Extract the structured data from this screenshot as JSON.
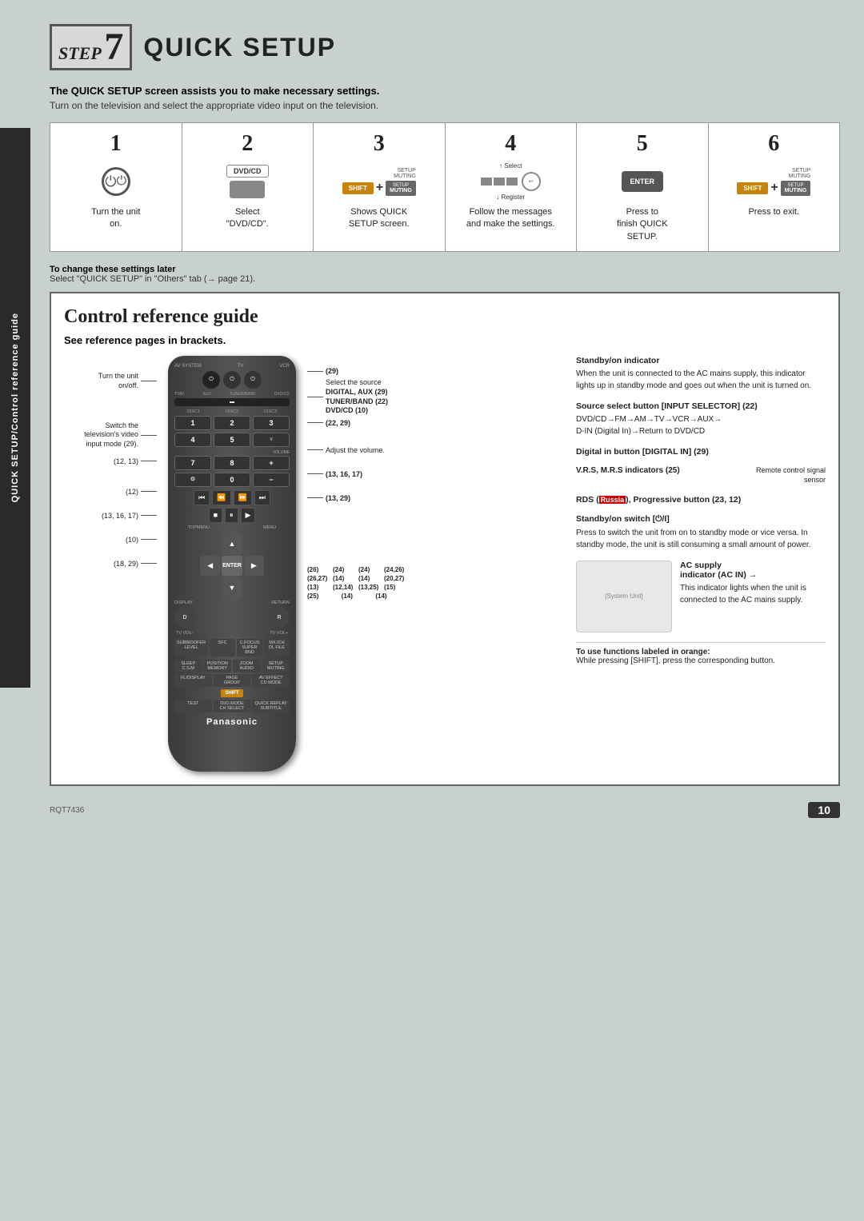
{
  "page": {
    "background_color": "#c0c8c8",
    "footer_code": "RQT7436",
    "page_number": "10"
  },
  "side_label": "QUICK SETUP/Control reference guide",
  "header": {
    "step_word": "STEP",
    "step_number": "7",
    "title": "QUICK SETUP"
  },
  "intro": {
    "bold_text": "The QUICK SETUP screen assists you to make necessary settings.",
    "normal_text": "Turn on the television and select the appropriate video input on the television."
  },
  "steps": [
    {
      "number": "1",
      "icon_type": "power",
      "desc_line1": "Turn the unit",
      "desc_line2": "on."
    },
    {
      "number": "2",
      "icon_type": "dvdcd",
      "btn_label": "DVD/CD",
      "desc_line1": "Select",
      "desc_line2": "\"DVD/CD\"."
    },
    {
      "number": "3",
      "icon_type": "shift_muting",
      "shift_label": "SHIFT",
      "setup_label": "SETUP",
      "muting_label": "MUTING",
      "desc_line1": "Shows QUICK",
      "desc_line2": "SETUP screen."
    },
    {
      "number": "4",
      "icon_type": "arrows_return",
      "select_label": "Select",
      "register_label": "Register",
      "return_label": "RETURN",
      "desc_line1": "Follow the messages",
      "desc_line2": "and make the settings."
    },
    {
      "number": "5",
      "icon_type": "enter",
      "enter_label": "ENTER",
      "desc_line1": "Press to",
      "desc_line2": "finish QUICK",
      "desc_line3": "SETUP."
    },
    {
      "number": "6",
      "icon_type": "shift_muting2",
      "shift_label": "SHIFT",
      "setup_label": "SETUP",
      "muting_label": "MUTING",
      "desc_line1": "Press to exit."
    }
  ],
  "change_note": {
    "bold": "To change these settings later",
    "text": "Select \"QUICK SETUP\" in \"Others\" tab (→ page 21)."
  },
  "control_ref": {
    "title": "Control reference guide",
    "subtitle": "See reference pages in brackets.",
    "annotations_left": [
      {
        "text": "Turn the unit\non/off.",
        "number": ""
      },
      {
        "text": "Switch the\ntelevision's video\ninput mode (29).",
        "number": "(29)"
      },
      {
        "text": "12, 13",
        "number": "(12, 13)"
      },
      {
        "text": "12",
        "number": "(12)"
      },
      {
        "text": "13, 16, 17",
        "number": "(13, 16, 17)"
      },
      {
        "text": "10",
        "number": "(10)"
      },
      {
        "text": "18, 29",
        "number": "(18, 29)"
      }
    ],
    "annotations_right": [
      {
        "text": "(29)",
        "desc": ""
      },
      {
        "text": "Select the source\nDIGITAL, AUX (29)\nTUNER/BAND (22)\nDVD/CD (10)"
      },
      {
        "text": "(22, 29)"
      },
      {
        "text": "Adjust the volume."
      },
      {
        "text": "(13, 16, 17)"
      },
      {
        "text": "(13, 29)"
      }
    ],
    "bottom_numbers_row1": [
      "(26)",
      "(24)",
      "(24)",
      "(24, 26)"
    ],
    "bottom_numbers_row2": [
      "(26, 27)",
      "(14)",
      "(14)",
      "(20, 27)"
    ],
    "bottom_numbers_row3": [
      "(13)",
      "(12, 14)",
      "(13, 25)",
      "(15)"
    ],
    "bottom_numbers_row4": [
      "(25)",
      "(14)",
      "(14)"
    ],
    "right_info": {
      "standby_indicator": {
        "title": "Standby/on indicator",
        "text": "When the unit is connected to the AC mains supply, this indicator lights up in standby mode and goes out when the unit is turned on."
      },
      "source_select": {
        "title": "Source select button [INPUT SELECTOR] (22)",
        "text": "DVD/CD→FM→AM→TV→VCR→AUX→\nD-IN (Digital In)→Return to DVD/CD"
      },
      "digital_in": {
        "title": "Digital in button [DIGITAL IN] (29)"
      },
      "vrs_mrs": {
        "title": "V.R.S, M.R.S indicators (25)",
        "right": "Remote control signal\nsensor"
      },
      "rds": {
        "title": "RDS (Russia), Progressive button (23, 12)"
      },
      "standby_switch": {
        "title": "Standby/on switch [⏻/I]",
        "text": "Press to switch the unit from on to standby mode or vice versa. In standby mode, the unit is still consuming a small amount of power."
      },
      "ac_supply": {
        "title": "AC supply\nindicator (AC IN) →",
        "text": "This indicator lights when the unit is connected to the AC mains supply."
      }
    },
    "functions_note": {
      "bold": "To use functions labeled in orange:",
      "text": "While pressing [SHIFT], press the corresponding button."
    }
  }
}
